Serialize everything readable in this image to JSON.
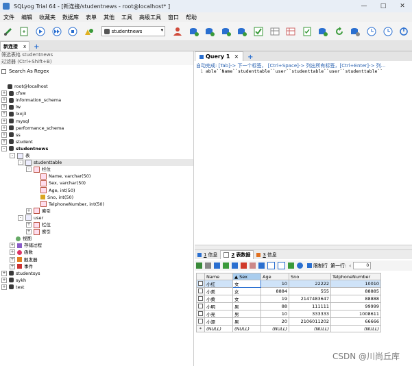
{
  "window": {
    "title": "SQLyog Trial 64 - [新连接/studentnews - root@localhost* ]",
    "controls": [
      "—",
      "□",
      "✕"
    ]
  },
  "menu": [
    "文件",
    "编辑",
    "收藏夹",
    "数据库",
    "表单",
    "其他",
    "工具",
    "高级工具",
    "窗口",
    "帮助"
  ],
  "toolbar": {
    "database_select": "studentnews",
    "icons": [
      "new-connection-icon",
      "new-query-icon",
      "execute-icon",
      "execute-all-icon",
      "stop-icon",
      "new-object-icon",
      "db-icon",
      "user-icon",
      "backup-icon",
      "restore-icon",
      "sync-icon",
      "schema-icon",
      "import-icon",
      "export-icon",
      "check-icon",
      "query-builder-icon",
      "refresh-icon",
      "settings-icon",
      "schedule-icon",
      "history-icon",
      "power-icon"
    ]
  },
  "connection_tab": {
    "label": "新连接",
    "close": "x",
    "add": "+"
  },
  "left_panel": {
    "filter_tables": "筛选表格 studentnews",
    "filter": "过滤器 (Ctrl+Shift+B)",
    "search_regex": "Search As Regex",
    "tree": [
      {
        "label": "root@localhost",
        "level": 0,
        "icon": "server",
        "exp": ""
      },
      {
        "label": "cfsw",
        "level": 0,
        "icon": "db",
        "exp": "+"
      },
      {
        "label": "information_schema",
        "level": 0,
        "icon": "db",
        "exp": "+"
      },
      {
        "label": "lw",
        "level": 0,
        "icon": "db",
        "exp": "+"
      },
      {
        "label": "lxxj3",
        "level": 0,
        "icon": "db",
        "exp": "+"
      },
      {
        "label": "mysql",
        "level": 0,
        "icon": "db",
        "exp": "+"
      },
      {
        "label": "performance_schema",
        "level": 0,
        "icon": "db",
        "exp": "+"
      },
      {
        "label": "ss",
        "level": 0,
        "icon": "db",
        "exp": "+"
      },
      {
        "label": "student",
        "level": 0,
        "icon": "db",
        "exp": "+"
      },
      {
        "label": "studentnews",
        "level": 0,
        "icon": "db",
        "exp": "-",
        "bold": true
      },
      {
        "label": "表",
        "level": 1,
        "icon": "tbl",
        "exp": "-"
      },
      {
        "label": "studenttable",
        "level": 2,
        "icon": "tbl",
        "exp": "-",
        "selected": true
      },
      {
        "label": "栏位",
        "level": 3,
        "icon": "fld",
        "exp": "-"
      },
      {
        "label": "Name, varchar(50)",
        "level": 4,
        "icon": "fld",
        "exp": ""
      },
      {
        "label": "Sex, varchar(50)",
        "level": 4,
        "icon": "fld",
        "exp": ""
      },
      {
        "label": "Age, int(50)",
        "level": 4,
        "icon": "fld",
        "exp": ""
      },
      {
        "label": "Sno, int(50)",
        "level": 4,
        "icon": "key",
        "exp": ""
      },
      {
        "label": "TelphoneNumber, int(50)",
        "level": 4,
        "icon": "fld",
        "exp": ""
      },
      {
        "label": "索引",
        "level": 3,
        "icon": "fld",
        "exp": "+"
      },
      {
        "label": "user",
        "level": 2,
        "icon": "tbl",
        "exp": "-"
      },
      {
        "label": "栏位",
        "level": 3,
        "icon": "fld",
        "exp": "+"
      },
      {
        "label": "索引",
        "level": 3,
        "icon": "fld",
        "exp": "+"
      },
      {
        "label": "视图",
        "level": 1,
        "icon": "view",
        "exp": ""
      },
      {
        "label": "存储过程",
        "level": 1,
        "icon": "proc",
        "exp": "+"
      },
      {
        "label": "函数",
        "level": 1,
        "icon": "func",
        "exp": "+"
      },
      {
        "label": "触发器",
        "level": 1,
        "icon": "trig",
        "exp": "+"
      },
      {
        "label": "事件",
        "level": 1,
        "icon": "evt",
        "exp": "+"
      },
      {
        "label": "studentsys",
        "level": 0,
        "icon": "db",
        "exp": "+"
      },
      {
        "label": "sykh",
        "level": 0,
        "icon": "db",
        "exp": "+"
      },
      {
        "label": "test",
        "level": 0,
        "icon": "db",
        "exp": "+"
      }
    ]
  },
  "query": {
    "tab_label": "Query 1",
    "add": "+",
    "hint": "自动完成: [Tab]-> 下一个标签， [Ctrl+Space]-> 列出所有标签，[Ctrl+Enter]-> 列...",
    "line_no": "1",
    "line_text": "able``Name``studenttable``user``studenttable``user``studenttable``"
  },
  "result_tabs": [
    {
      "num": "1",
      "label": "信息",
      "active": false,
      "color": "#2a6fd0"
    },
    {
      "num": "2",
      "label": "表数据",
      "active": true,
      "color": "#777777"
    },
    {
      "num": "3",
      "label": "信息",
      "active": false,
      "color": "#e07020"
    }
  ],
  "grid_toolbar": {
    "limit_label": "限制行",
    "first_row_label": "第一行:",
    "first_row_value": "0",
    "prev": "‹"
  },
  "table": {
    "columns": [
      "Name",
      "Sex",
      "Age",
      "Sno",
      "TelphoneNumber"
    ],
    "sorted_column": "Sex",
    "rows": [
      [
        "小红",
        "女",
        "10",
        "22222",
        "10010"
      ],
      [
        "小美",
        "女",
        "8884",
        "555",
        "88885"
      ],
      [
        "小黄",
        "女",
        "19",
        "2147483647",
        "88888"
      ],
      [
        "小明",
        "男",
        "88",
        "111111",
        "99999"
      ],
      [
        "小亮",
        "男",
        "10",
        "333333",
        "1008611"
      ],
      [
        "小源",
        "男",
        "20",
        "2106011202",
        "66666"
      ]
    ],
    "null_row": [
      "(NULL)",
      "(NULL)",
      "(NULL)",
      "(NULL)",
      "(NULL)"
    ],
    "null_marker": "*"
  },
  "watermark": "CSDN @川尚丘库"
}
